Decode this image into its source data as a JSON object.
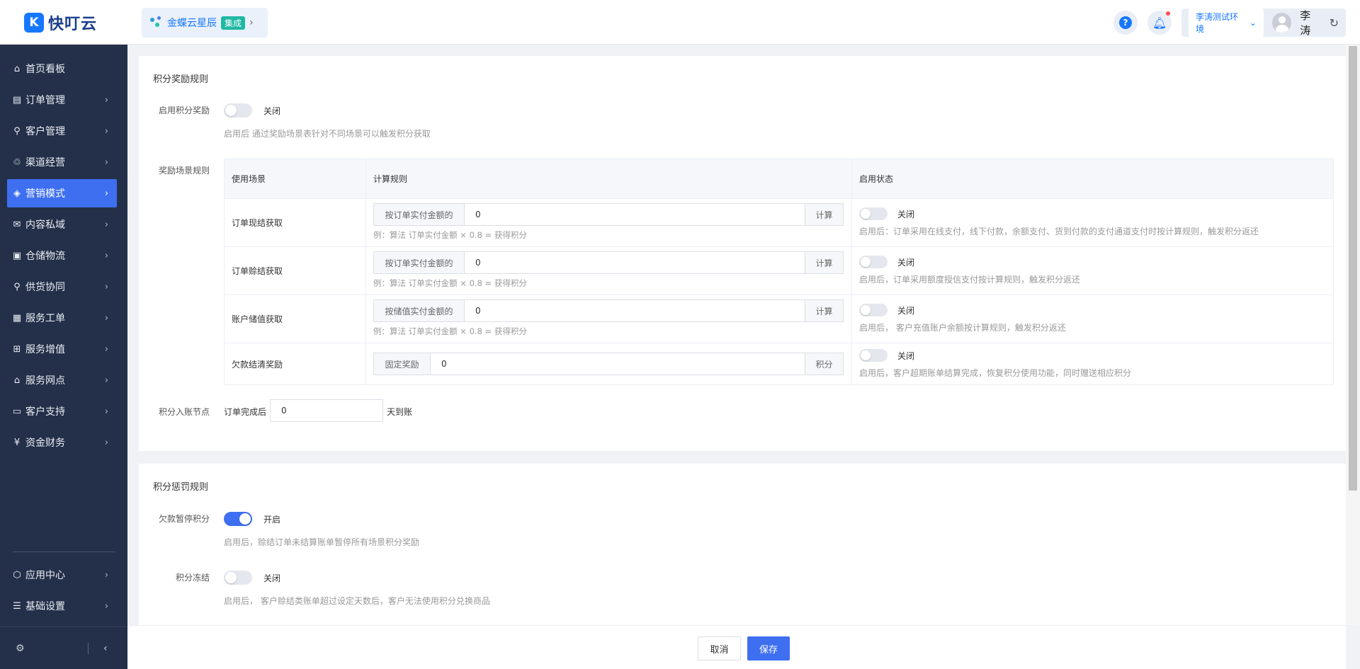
{
  "header": {
    "logo_mark": "K",
    "logo_text": "快叮云",
    "app_name": "金蝶云星辰",
    "app_badge": "集成",
    "help_label": "?",
    "env_label": "李涛测试环境",
    "user_name": "李涛"
  },
  "sidebar": {
    "items": [
      {
        "label": "首页看板",
        "icon": "home-icon"
      },
      {
        "label": "订单管理",
        "icon": "order-icon"
      },
      {
        "label": "客户管理",
        "icon": "user-icon"
      },
      {
        "label": "渠道经营",
        "icon": "channel-icon"
      },
      {
        "label": "营销模式",
        "icon": "tag-icon"
      },
      {
        "label": "内容私域",
        "icon": "mail-icon"
      },
      {
        "label": "仓储物流",
        "icon": "box-icon"
      },
      {
        "label": "供货协同",
        "icon": "user-link-icon"
      },
      {
        "label": "服务工单",
        "icon": "ticket-icon"
      },
      {
        "label": "服务增值",
        "icon": "bag-icon"
      },
      {
        "label": "服务网点",
        "icon": "store-icon"
      },
      {
        "label": "客户支持",
        "icon": "support-icon"
      },
      {
        "label": "资金财务",
        "icon": "yen-icon"
      }
    ],
    "bottom_items": [
      {
        "label": "应用中心",
        "icon": "cube-icon"
      },
      {
        "label": "基础设置",
        "icon": "settings-icon"
      }
    ],
    "active_index": 4
  },
  "reward": {
    "section_title": "积分奖励规则",
    "enable_label": "启用积分奖励",
    "enable_state": "关闭",
    "enable_help": "启用后 通过奖励场景表针对不同场景可以触发积分获取",
    "scene_label": "奖励场景规则",
    "table": {
      "headers": [
        "使用场景",
        "计算规则",
        "启用状态"
      ],
      "rows": [
        {
          "scene": "订单现结获取",
          "prefix": "按订单实付金额的",
          "value": "0",
          "suffix": "计算",
          "example": "例：算法 订单实付金额 × 0.8 = 获得积分",
          "state": "关闭",
          "desc": "启用后：订单采用在线支付，线下付款，余额支付、货到付款的支付通道支付时按计算规则，触发积分返还"
        },
        {
          "scene": "订单赊结获取",
          "prefix": "按订单实付金额的",
          "value": "0",
          "suffix": "计算",
          "example": "例：算法 订单实付金额 × 0.8 = 获得积分",
          "state": "关闭",
          "desc": "启用后，订单采用额度授信支付按计算规则，触发积分返还"
        },
        {
          "scene": "账户储值获取",
          "prefix": "按储值实付金额的",
          "value": "0",
          "suffix": "计算",
          "example": "例：算法 订单实付金额 × 0.8 = 获得积分",
          "state": "关闭",
          "desc": "启用后， 客户充值账户余额按计算规则，触发积分返还"
        },
        {
          "scene": "欠款结清奖励",
          "prefix": "固定奖励",
          "value": "0",
          "suffix": "积分",
          "example": "",
          "state": "关闭",
          "desc": "启用后，客户超期账单结算完成，恢复积分使用功能，同时赠送相应积分"
        }
      ]
    },
    "entry_label": "积分入账节点",
    "entry_prefix": "订单完成后",
    "entry_value": "0",
    "entry_suffix": "天到账"
  },
  "penalty": {
    "section_title": "积分惩罚规则",
    "debt_label": "欠款暂停积分",
    "debt_state": "开启",
    "debt_help": "启用后，赊结订单未结算账单暂停所有场景积分奖励",
    "freeze_label": "积分冻结",
    "freeze_state": "关闭",
    "freeze_help": "启用后， 客户赊结类账单超过设定天数后，客户无法使用积分兑换商品"
  },
  "actions": {
    "cancel": "取消",
    "save": "保存"
  },
  "colors": {
    "accent": "#3e6ff1",
    "sidebar_bg": "#243049",
    "brand": "#1677ff"
  }
}
